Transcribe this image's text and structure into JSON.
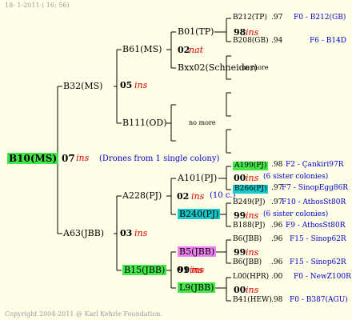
{
  "header": {
    "date": "18- 1-2011 ( 16: 56)"
  },
  "footer": {
    "copyright": "Copyright 2004-2011 @ Karl Kehrle Foundation."
  },
  "root": {
    "name": "B10(MS)",
    "year": "07",
    "ins": "ins",
    "drones": "(Drones from 1 single colony)",
    "color": "#44e64a"
  },
  "gen1": {
    "top": {
      "name": "B32(MS)",
      "year": "05",
      "ins": "ins"
    },
    "bottom": {
      "name": "A63(JBB)",
      "year": "03",
      "ins": "ins"
    }
  },
  "gen2": {
    "b61": {
      "name": "B61(MS)"
    },
    "b111": {
      "name": "B111(OD)",
      "nomore": "no more"
    },
    "a228": {
      "name": "A228(PJ)",
      "year": "02",
      "ins": "ins",
      "note": "(10 c.)"
    },
    "b15": {
      "name": "B15(JBB)",
      "year": "01",
      "ins": "ins",
      "color": "#44e64a"
    }
  },
  "gen3": {
    "b01": {
      "name": "B01(TP)",
      "year": "02",
      "ins": "nat"
    },
    "bxx02": {
      "name": "Bxx02(Schneider)",
      "nomore": "no more"
    },
    "a101": {
      "name": "A101(PJ)"
    },
    "b240": {
      "name": "B240(PJ)",
      "color": "#18c7c7"
    },
    "b5": {
      "name": "B5(JBB)",
      "year": "99",
      "ins": "ins",
      "color": "#ee7ff0"
    },
    "l9": {
      "name": "L9(JBB)",
      "year": "00",
      "ins": "ins",
      "color": "#44e64a"
    }
  },
  "gen4": [
    {
      "name": "B212(TP)",
      "score": ".97",
      "ped": "F0 - B212(GB)"
    },
    {
      "year": "98",
      "ins": "ins"
    },
    {
      "name": "B208(GB)",
      "score": ".94",
      "ped": "F6 - B14D"
    },
    {
      "name": "A199(PJ)",
      "score": ".98",
      "ped": "F2 - Çankiri97R",
      "color": "#44e64a"
    },
    {
      "year": "00",
      "ins": "ins",
      "note": "(6 sister colonies)"
    },
    {
      "name": "B266(PJ)",
      "score": ".97",
      "ped": "F7 - SinopEgg86R",
      "color": "#18c7c7"
    },
    {
      "name": "B249(PJ)",
      "score": ".97",
      "ped": "F10 - AthosSt80R"
    },
    {
      "year": "99",
      "ins": "ins",
      "note": "(6 sister colonies)"
    },
    {
      "name": "B188(PJ)",
      "score": ".96",
      "ped": "F9 - AthosSt80R"
    },
    {
      "name": "B6(JBB)",
      "score": ".96",
      "ped": "F15 - Sinop62R"
    },
    {
      "year": "99",
      "ins": "ins"
    },
    {
      "name": "B6(JBB)",
      "score": ".96",
      "ped": "F15 - Sinop62R"
    },
    {
      "name": "L00(HPR)",
      "score": ".00",
      "ped": "F0 - NewZ100R"
    },
    {
      "year": "00",
      "ins": "ins"
    },
    {
      "name": "B41(HEW)",
      "score": ".98",
      "ped": "F0 - B387(AGU)"
    }
  ]
}
